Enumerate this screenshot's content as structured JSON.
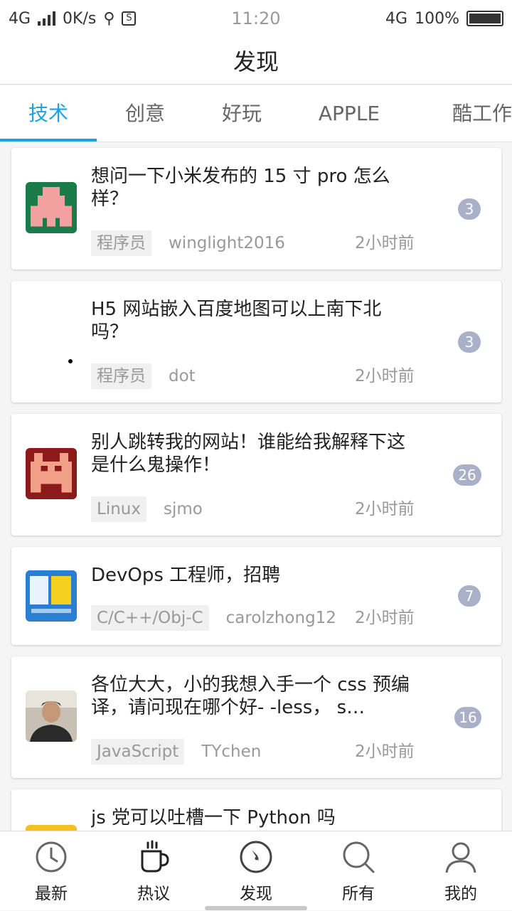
{
  "status": {
    "net_left": "4G",
    "speed": "0K/s",
    "s_icon": "S",
    "time": "11:20",
    "net_right": "4G",
    "battery": "100%"
  },
  "header": {
    "title": "发现"
  },
  "tabs": [
    {
      "label": "技术",
      "active": true
    },
    {
      "label": "创意"
    },
    {
      "label": "好玩"
    },
    {
      "label": "APPLE"
    },
    {
      "label": "酷工作"
    }
  ],
  "topics": [
    {
      "title": "想问一下小米发布的 15 寸 pro 怎么样？",
      "node": "程序员",
      "author": "winglight2016",
      "time": "2小时前",
      "replies": "3",
      "avatar": "pixel-green-avatar"
    },
    {
      "title": "H5 网站嵌入百度地图可以上南下北吗？",
      "node": "程序员",
      "author": "dot",
      "time": "2小时前",
      "replies": "3",
      "avatar": "dot-avatar"
    },
    {
      "title": "别人跳转我的网站！谁能给我解释下这是什么鬼操作！",
      "node": "Linux",
      "author": "sjmo",
      "time": "2小时前",
      "replies": "26",
      "avatar": "pixel-red-avatar"
    },
    {
      "title": "DevOps 工程师，招聘",
      "node": "C/C++/Obj-C",
      "author": "carolzhong12",
      "time": "2小时前",
      "replies": "7",
      "avatar": "blue-logo-avatar"
    },
    {
      "title": "各位大大，小的我想入手一个 css 预编译，请问现在哪个好- -less， s…",
      "node": "JavaScript",
      "author": "TYchen",
      "time": "2小时前",
      "replies": "16",
      "avatar": "photo-avatar"
    },
    {
      "title": "js 党可以吐槽一下 Python 吗",
      "node": "",
      "author": "",
      "time": "",
      "replies": "",
      "avatar": "yellow-avatar"
    }
  ],
  "nav": [
    {
      "label": "最新",
      "icon": "clock-icon"
    },
    {
      "label": "热议",
      "icon": "coffee-cup-icon"
    },
    {
      "label": "发现",
      "icon": "compass-icon"
    },
    {
      "label": "所有",
      "icon": "search-icon"
    },
    {
      "label": "我的",
      "icon": "user-icon"
    }
  ],
  "colors": {
    "accent": "#1ea2e0",
    "badge": "#aab0c8"
  }
}
